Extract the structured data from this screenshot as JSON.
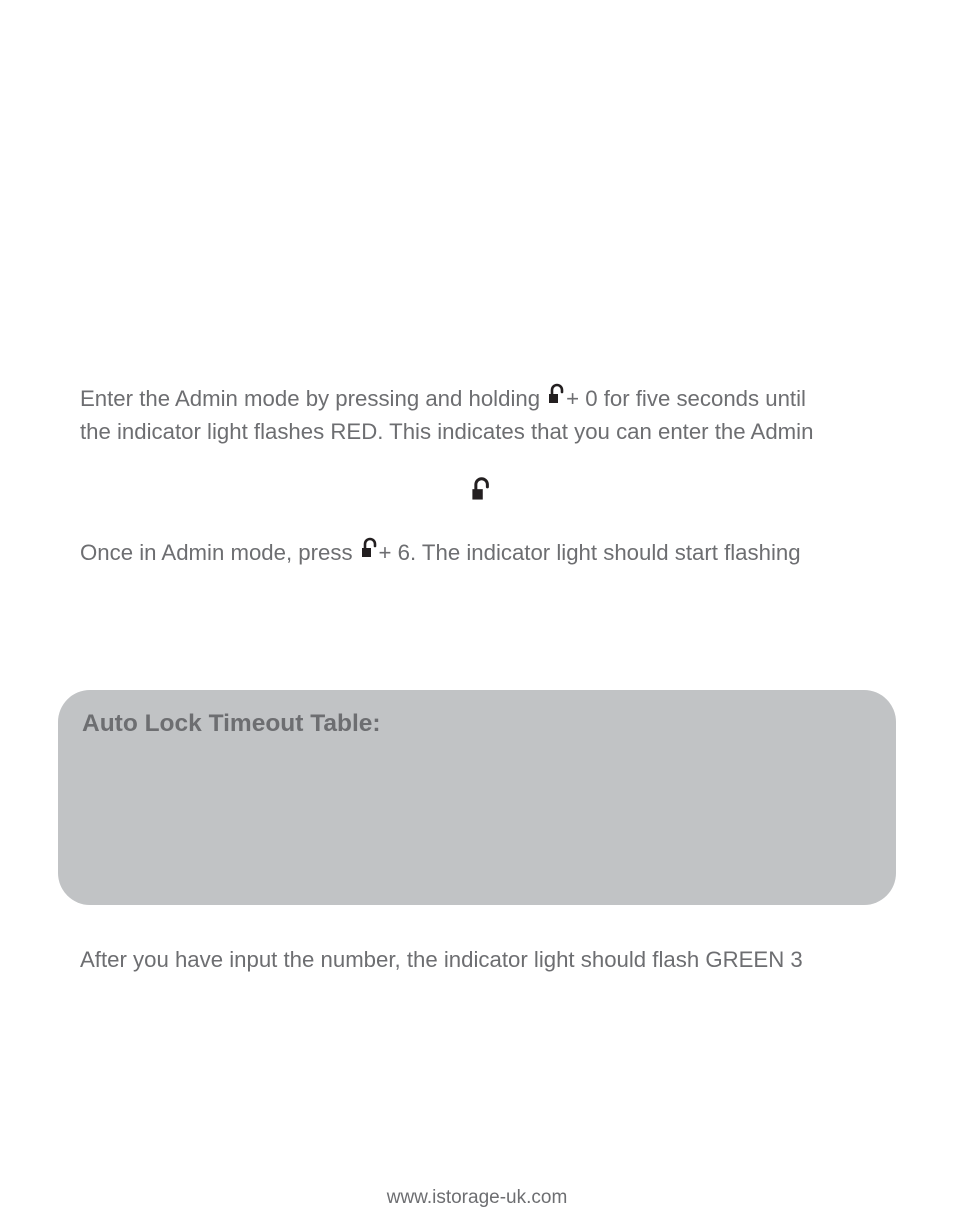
{
  "step1": {
    "line1_before": "Enter the Admin mode by pressing and holding ",
    "line1_after": " + 0 for five seconds until",
    "line2": "the indicator light flashes RED. This indicates that you can enter the Admin"
  },
  "step2": {
    "before": "Once in Admin mode, press ",
    "after": " + 6. The indicator light should start flashing"
  },
  "table": {
    "title": "Auto Lock Timeout Table:"
  },
  "after": "After you have input the number, the indicator light should flash GREEN 3",
  "footer": "www.istorage-uk.com",
  "icons": {
    "lock": "lock-icon"
  }
}
